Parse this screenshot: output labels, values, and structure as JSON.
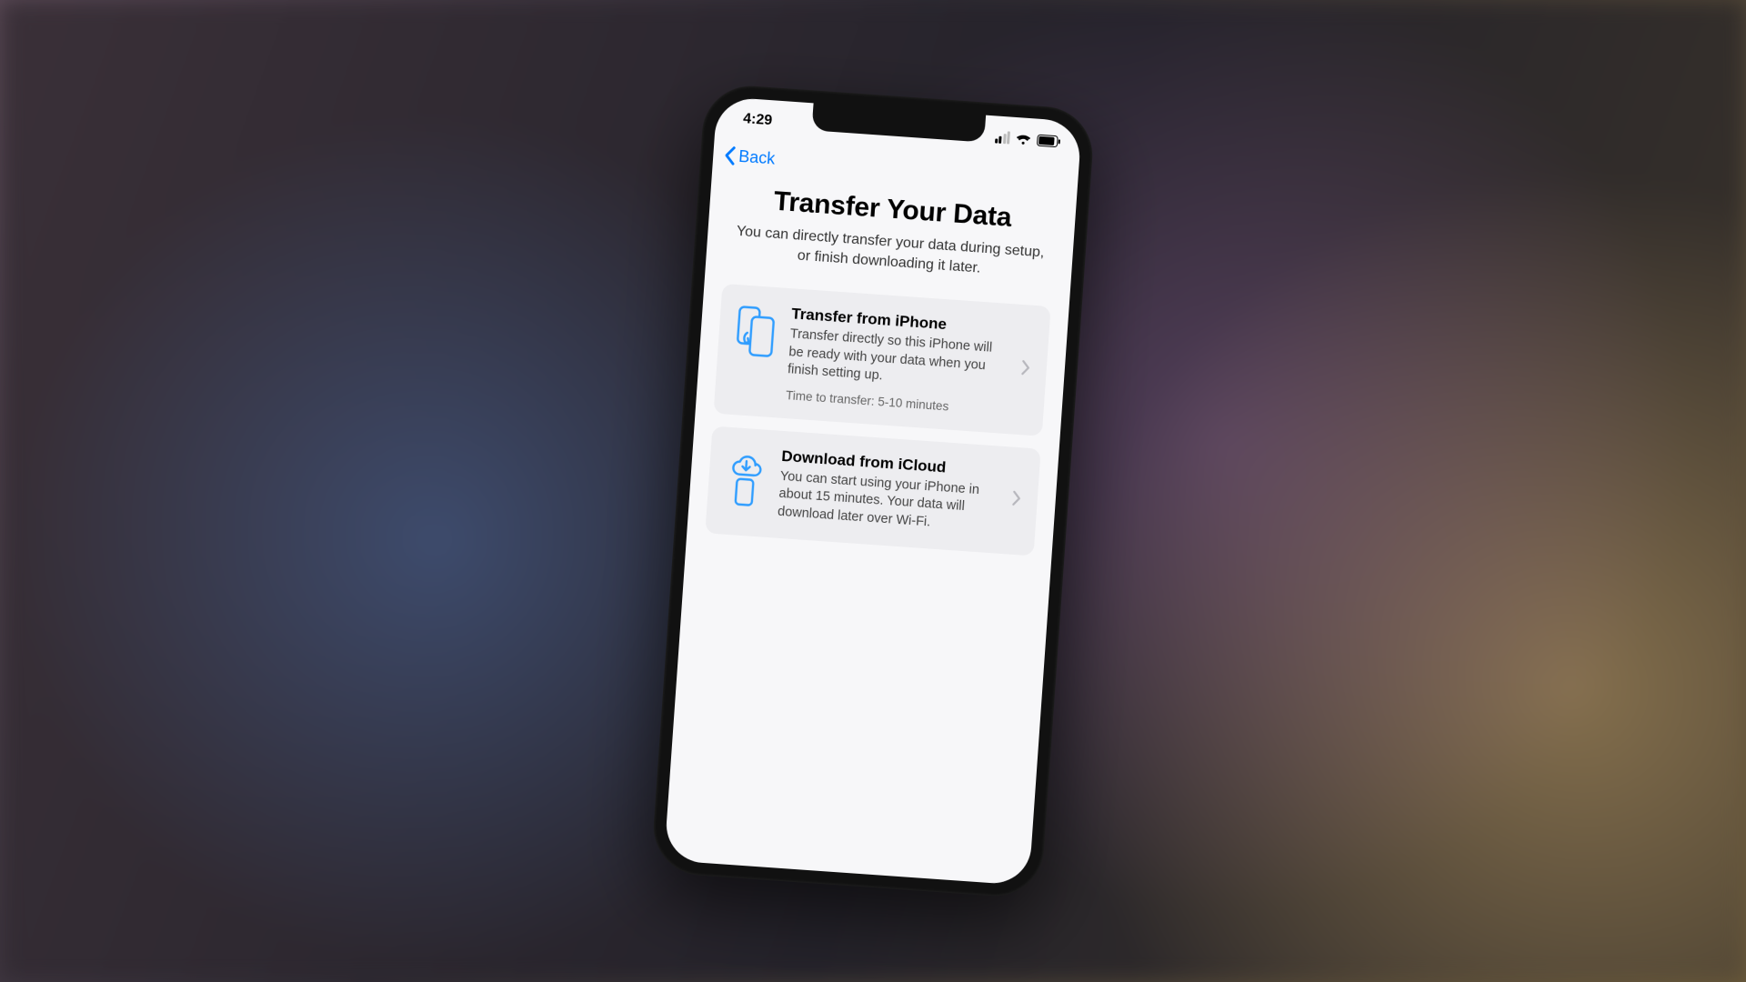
{
  "status": {
    "time": "4:29"
  },
  "nav": {
    "back_label": "Back"
  },
  "header": {
    "title": "Transfer Your Data",
    "subtitle": "You can directly transfer your data during setup, or finish downloading it later."
  },
  "options": [
    {
      "icon": "phone-transfer-icon",
      "title": "Transfer from iPhone",
      "description": "Transfer directly so this iPhone will be ready with your data when you finish setting up.",
      "meta": "Time to transfer: 5-10 minutes"
    },
    {
      "icon": "icloud-download-icon",
      "title": "Download from iCloud",
      "description": "You can start using your iPhone in about 15 minutes. Your data will download later over Wi-Fi.",
      "meta": ""
    }
  ],
  "colors": {
    "accent": "#007aff",
    "icon_blue": "#2f9dff"
  }
}
